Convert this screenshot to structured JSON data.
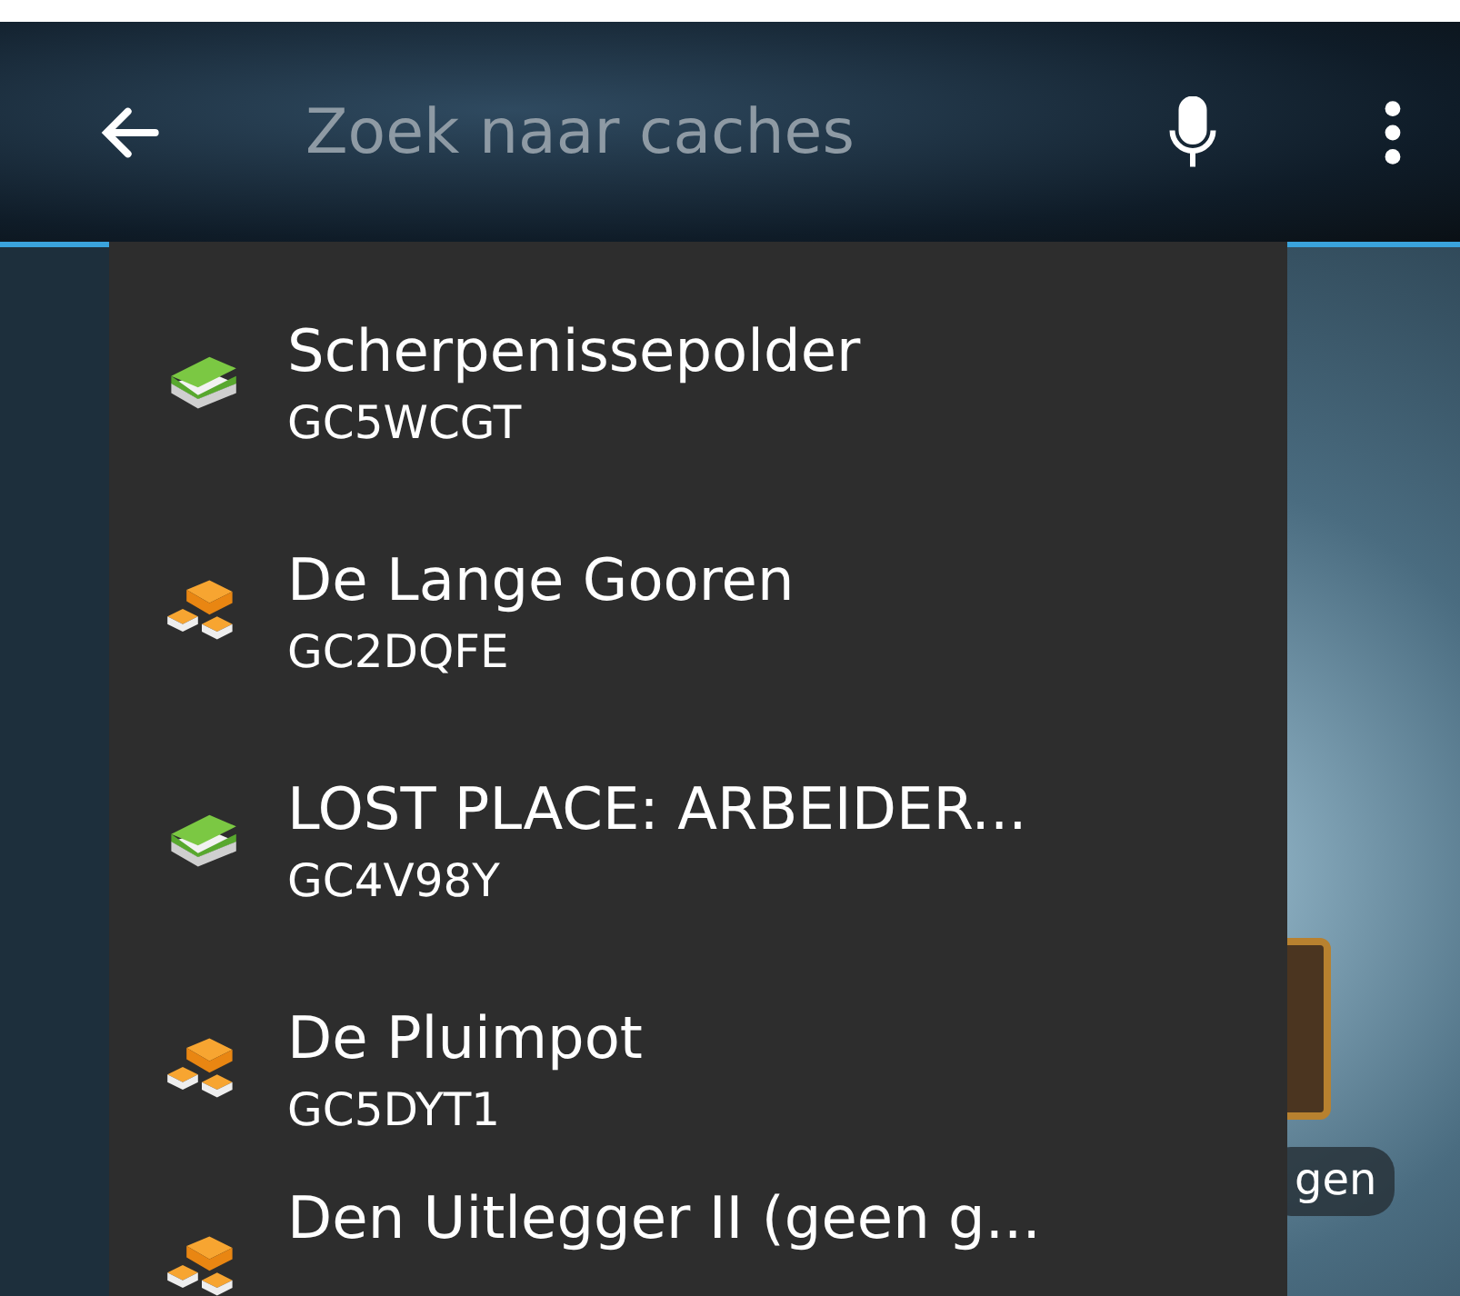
{
  "search": {
    "placeholder": "Zoek naar caches"
  },
  "suggestions": [
    {
      "kind": "traditional",
      "name": "Scherpenissepolder",
      "code": "GC5WCGT"
    },
    {
      "kind": "multi",
      "name": "De Lange Gooren",
      "code": "GC2DQFE"
    },
    {
      "kind": "traditional",
      "name": "LOST PLACE: ARBEIDER...",
      "code": "GC4V98Y"
    },
    {
      "kind": "multi",
      "name": "De Pluimpot",
      "code": "GC5DYT1"
    },
    {
      "kind": "multi",
      "name": "Den Uitlegger II (geen g..."
    }
  ],
  "background_chip": {
    "label": "gen"
  }
}
